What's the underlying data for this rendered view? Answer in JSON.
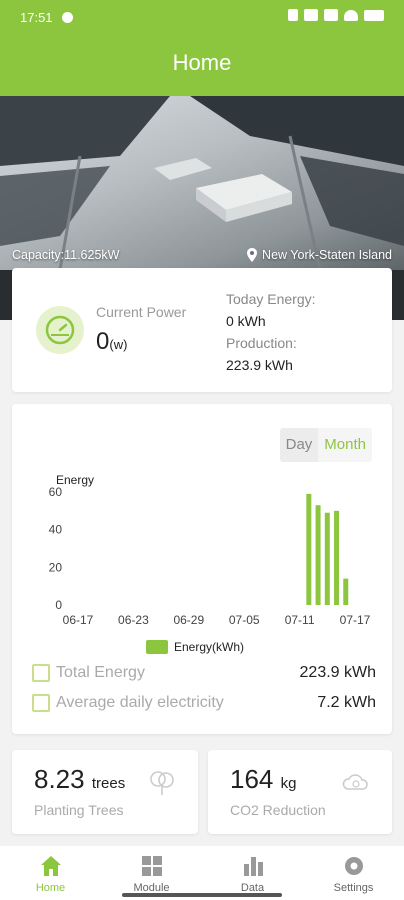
{
  "status_bar": {
    "time": "17:51"
  },
  "header": {
    "title": "Home"
  },
  "banner": {
    "capacity": "Capacity:11.625kW",
    "location": "New York-Staten Island"
  },
  "power": {
    "current_label": "Current Power",
    "current_value": "0",
    "current_unit": "(w)",
    "today_label": "Today Energy:",
    "today_value": "0 kWh",
    "production_label": "Production:",
    "production_value": "223.9 kWh"
  },
  "chart_toggle": {
    "day": "Day",
    "month": "Month",
    "selected": "Month"
  },
  "chart_data": {
    "type": "bar",
    "ylabel": "Energy",
    "ylim": [
      0,
      60
    ],
    "yticks": [
      0,
      20,
      40,
      60
    ],
    "xticks": [
      "06-17",
      "06-23",
      "06-29",
      "07-05",
      "07-11",
      "07-17"
    ],
    "legend": "Energy(kWh)",
    "x": [
      "07-12",
      "07-13",
      "07-14",
      "07-15",
      "07-16"
    ],
    "values": [
      59,
      53,
      49,
      50,
      14
    ],
    "color": "#8cc63f"
  },
  "stats": {
    "total_label": "Total Energy",
    "total_value": "223.9 kWh",
    "avg_label": "Average daily electricity",
    "avg_value": "7.2 kWh"
  },
  "trees": {
    "value": "8.23",
    "unit": "trees",
    "label": "Planting Trees"
  },
  "co2": {
    "value": "164",
    "unit": "kg",
    "label": "CO2 Reduction"
  },
  "nav": [
    {
      "label": "Home",
      "icon": "home-icon",
      "active": true
    },
    {
      "label": "Module",
      "icon": "grid-icon",
      "active": false
    },
    {
      "label": "Data",
      "icon": "bar-chart-icon",
      "active": false
    },
    {
      "label": "Settings",
      "icon": "gear-icon",
      "active": false
    }
  ],
  "colors": {
    "accent": "#8cc63f",
    "accent_light": "#e6f2cd"
  }
}
